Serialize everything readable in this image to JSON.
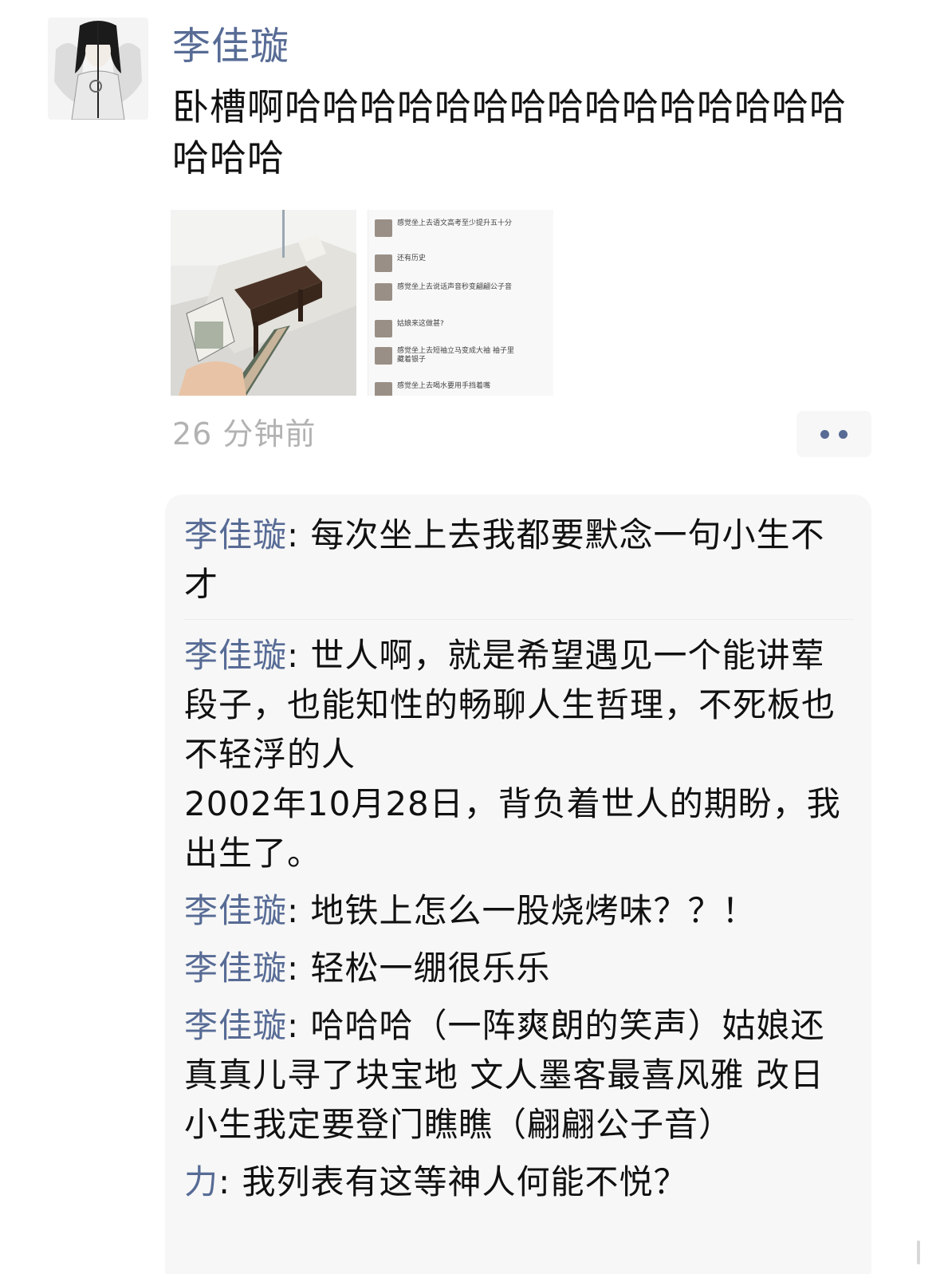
{
  "post": {
    "author": "李佳璇",
    "text": "卧槽啊哈哈哈哈哈哈哈哈哈哈哈哈哈哈哈哈哈哈",
    "timestamp": "26 分钟前",
    "images": [
      {
        "icon": "photo-sofa"
      },
      {
        "icon": "photo-chat-screenshot",
        "lines": [
          "感觉坐上去语文高考至少提升五十分",
          "还有历史",
          "感觉坐上去说话声音秒变翩翩公子音",
          "姑娘来这做甚?",
          "感觉坐上去短袖立马变成大袖 袖子里藏着银子",
          "感觉坐上去喝水要用手挡着嘴"
        ]
      }
    ],
    "more_icon": "more-dots-icon"
  },
  "comments": [
    {
      "author": "李佳璇",
      "sep": ": ",
      "text": "每次坐上去我都要默念一句小生不才"
    },
    {
      "author": "李佳璇",
      "sep": ": ",
      "text": "世人啊，就是希望遇见一个能讲荤段子，也能知性的畅聊人生哲理，不死板也不轻浮的人\n2002年10月28日，背负着世人的期盼，我出生了。"
    },
    {
      "author": "李佳璇",
      "sep": ": ",
      "text": "地铁上怎么一股烧烤味？？！"
    },
    {
      "author": "李佳璇",
      "sep": ": ",
      "text": "轻松一绷很乐乐"
    },
    {
      "author": "李佳璇",
      "sep": ": ",
      "text": "哈哈哈（一阵爽朗的笑声）姑娘还真真儿寻了块宝地 文人墨客最喜风雅 改日小生我定要登门瞧瞧（翩翩公子音）"
    },
    {
      "author": "力",
      "sep": ": ",
      "text": "我列表有这等神人何能不悦？"
    }
  ],
  "colors": {
    "link": "#576b95",
    "timestamp": "#b2b2b2",
    "comment_bg": "#f7f7f7"
  }
}
